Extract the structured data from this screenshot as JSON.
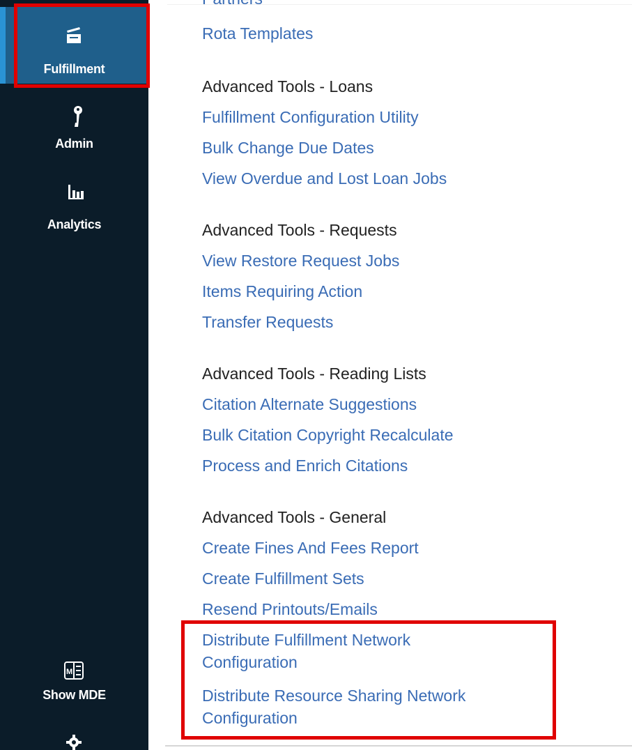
{
  "sidebar": {
    "fulfillment_label": "Fulfillment",
    "admin_label": "Admin",
    "analytics_label": "Analytics",
    "show_mde_label": "Show MDE",
    "icons": {
      "fulfillment": "fulfillment-icon",
      "admin": "key-icon",
      "analytics": "analytics-icon",
      "show_mde": "mde-icon",
      "settings": "gear-icon"
    },
    "active_item": "Fulfillment"
  },
  "content": {
    "partial_top_text": "Partners",
    "rota_templates": "Rota Templates",
    "sections": {
      "loans": {
        "heading": "Advanced Tools - Loans",
        "links": [
          "Fulfillment Configuration Utility",
          "Bulk Change Due Dates",
          "View Overdue and Lost Loan Jobs"
        ]
      },
      "requests": {
        "heading": "Advanced Tools - Requests",
        "links": [
          "View Restore Request Jobs",
          "Items Requiring Action",
          "Transfer Requests"
        ]
      },
      "reading_lists": {
        "heading": "Advanced Tools - Reading Lists",
        "links": [
          "Citation Alternate Suggestions",
          "Bulk Citation Copyright Recalculate",
          "Process and Enrich Citations"
        ]
      },
      "general": {
        "heading": "Advanced Tools - General",
        "links": [
          "Create Fines And Fees Report",
          "Create Fulfillment Sets",
          "Resend Printouts/Emails",
          "Distribute Fulfillment Network",
          "Configuration",
          "Distribute Resource Sharing Network",
          "Configuration"
        ]
      }
    }
  },
  "colors": {
    "sidebar_bg": "#0b1c29",
    "active_bg": "#1f5f8b",
    "active_accent": "#2a93d5",
    "link": "#3a6cb5",
    "heading": "#222222",
    "highlight": "#e00000"
  }
}
